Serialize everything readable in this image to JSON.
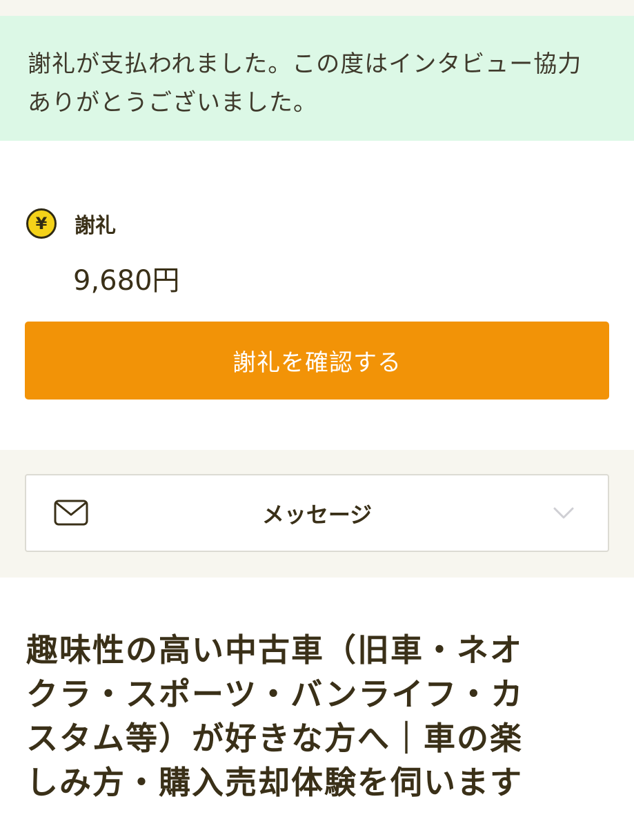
{
  "notice": {
    "text": "謝礼が支払われました。この度はインタビュー協力\nありがとうございました。"
  },
  "reward": {
    "icon": "yen-coin-icon",
    "icon_glyph": "¥",
    "label": "謝礼",
    "amount": "9,680円",
    "confirm_button_label": "謝礼を確認する"
  },
  "message": {
    "icon": "mail-icon",
    "label": "メッセージ",
    "expand_icon": "chevron-down-icon"
  },
  "project": {
    "title": "趣味性の高い中古車（旧車・ネオ\nクラ・スポーツ・バンライフ・カ\nスタム等）が好きな方へ｜車の楽\nしみ方・購入売却体験を伺います"
  },
  "colors": {
    "notice_background": "#dcf8e6",
    "accent_orange": "#f29307",
    "coin_yellow": "#f4d219",
    "section_background": "#f7f6ef",
    "text_dark": "#3a3018"
  }
}
